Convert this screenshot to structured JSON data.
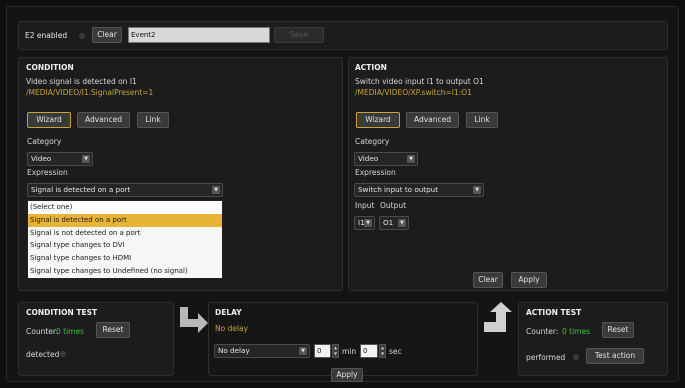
{
  "top": {
    "enabled_label": "E2 enabled",
    "clear_label": "Clear",
    "event_name": "Event2",
    "save_label": "Save"
  },
  "condition": {
    "heading": "CONDITION",
    "description": "Video signal is detected on I1",
    "path": "/MEDIA/VIDEO/I1.SignalPresent=1",
    "tabs": {
      "wizard": "Wizard",
      "advanced": "Advanced",
      "link": "Link"
    },
    "category_label": "Category",
    "category_value": "Video",
    "expression_label": "Expression",
    "expression_value": "Signal is detected on a port",
    "options": [
      "(Select one)",
      "Signal is detected on a port",
      "Signal is not detected on a port",
      "Signal type changes to DVI",
      "Signal type changes to HDMI",
      "Signal type changes to Undefined (no signal)"
    ]
  },
  "action": {
    "heading": "ACTION",
    "description": "Switch video input I1 to output O1",
    "path": "/MEDIA/VIDEO/XP.switch=I1:O1",
    "tabs": {
      "wizard": "Wizard",
      "advanced": "Advanced",
      "link": "Link"
    },
    "category_label": "Category",
    "category_value": "Video",
    "expression_label": "Expression",
    "expression_value": "Switch input to output",
    "input_label": "Input",
    "output_label": "Output",
    "input_value": "I1",
    "output_value": "O1",
    "clear_label": "Clear",
    "apply_label": "Apply"
  },
  "condition_test": {
    "heading": "CONDITION TEST",
    "counter_prefix": "Counter:",
    "counter_value": "0 times",
    "reset_label": "Reset",
    "status_label": "detected"
  },
  "delay": {
    "heading": "DELAY",
    "status": "No delay",
    "select_value": "No delay",
    "min_value": "0",
    "min_label": "min",
    "sec_value": "0",
    "sec_label": "sec",
    "apply_label": "Apply"
  },
  "action_test": {
    "heading": "ACTION TEST",
    "counter_prefix": "Counter:",
    "counter_value": "0 times",
    "reset_label": "Reset",
    "status_label": "performed",
    "test_label": "Test action"
  },
  "colors": {
    "accent": "#c9a23a",
    "counter": "#3fbf3f",
    "highlight": "#e8b436"
  }
}
